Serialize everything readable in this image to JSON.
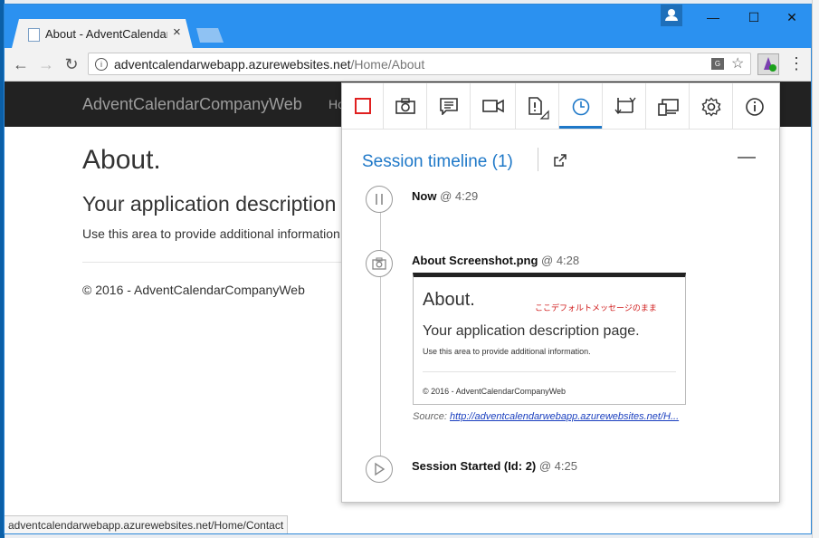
{
  "browser": {
    "tab_title": "About - AdventCalendarCompanyWeb",
    "tab_close": "×",
    "url_host": "adventcalendarwebapp.azurewebsites.net",
    "url_path": "/Home/About",
    "status_url": "adventcalendarwebapp.azurewebsites.net/Home/Contact",
    "window_controls": {
      "minimize": "—",
      "maximize": "☐",
      "close": "✕"
    },
    "nav": {
      "back": "←",
      "forward": "→",
      "reload": "↻"
    }
  },
  "site": {
    "brand": "AdventCalendarCompanyWeb",
    "nav_home": "Ho",
    "heading": "About.",
    "subheading": "Your application description",
    "paragraph": "Use this area to provide additional information",
    "footer": "© 2016 - AdventCalendarCompanyWeb"
  },
  "popup": {
    "tools": [
      "stop-recording-icon",
      "camera-icon",
      "note-icon",
      "video-icon",
      "bug-report-icon",
      "timeline-icon",
      "screen-capture-icon",
      "devices-icon",
      "settings-icon",
      "info-icon"
    ],
    "active_tool": "timeline-icon",
    "timeline_title": "Session timeline (1)",
    "entries": [
      {
        "label": "Now",
        "time": "@ 4:29"
      },
      {
        "label": "About Screenshot.png",
        "time": "@ 4:28"
      },
      {
        "label": "Session Started (Id: 2)",
        "time": "@ 4:25"
      }
    ],
    "thumbnail": {
      "heading": "About.",
      "note": "ここデフォルトメッセージのまま",
      "subheading": "Your application description page.",
      "paragraph": "Use this area to provide additional information.",
      "footer": "© 2016 - AdventCalendarCompanyWeb"
    },
    "source_label": "Source:",
    "source_link": "http://adventcalendarwebapp.azurewebsites.net/H..."
  },
  "colors": {
    "titlebar": "#2b91f0",
    "accent": "#1e78c8",
    "navbar": "#222222",
    "stop_icon": "#e02020"
  }
}
